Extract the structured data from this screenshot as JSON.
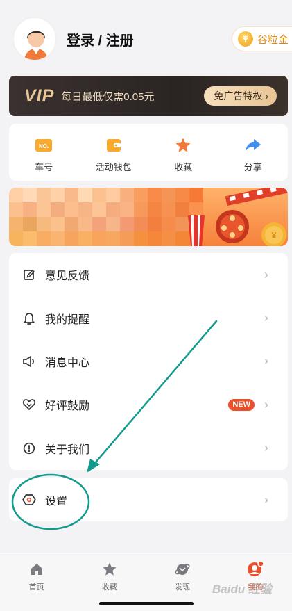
{
  "header": {
    "login_label": "登录 / 注册",
    "gold_label": "谷粒金"
  },
  "vip": {
    "logo": "VIP",
    "text": "每日最低仅需0.05元",
    "button_label": "免广告特权",
    "chevron": "›"
  },
  "quick_actions": [
    {
      "label": "车号",
      "icon": "ticket-no-icon",
      "badge_text": "NO."
    },
    {
      "label": "活动钱包",
      "icon": "wallet-icon"
    },
    {
      "label": "收藏",
      "icon": "star-icon"
    },
    {
      "label": "分享",
      "icon": "share-icon"
    }
  ],
  "menu": [
    {
      "label": "意见反馈",
      "icon": "feedback-icon"
    },
    {
      "label": "我的提醒",
      "icon": "bell-icon"
    },
    {
      "label": "消息中心",
      "icon": "speaker-icon"
    },
    {
      "label": "好评鼓励",
      "icon": "heart-icon",
      "badge": "NEW"
    },
    {
      "label": "关于我们",
      "icon": "info-icon"
    }
  ],
  "settings": {
    "label": "设置",
    "icon": "settings-icon"
  },
  "tabs": [
    {
      "label": "首页",
      "icon": "home-icon",
      "active": false
    },
    {
      "label": "收藏",
      "icon": "star-icon",
      "active": false
    },
    {
      "label": "发现",
      "icon": "planet-icon",
      "active": false
    },
    {
      "label": "我的",
      "icon": "profile-icon",
      "active": true
    }
  ],
  "watermark": "Baidu 经验",
  "colors": {
    "accent": "#e8512b",
    "vip_gold": "#e9c79a",
    "annotation": "#129a8e"
  }
}
